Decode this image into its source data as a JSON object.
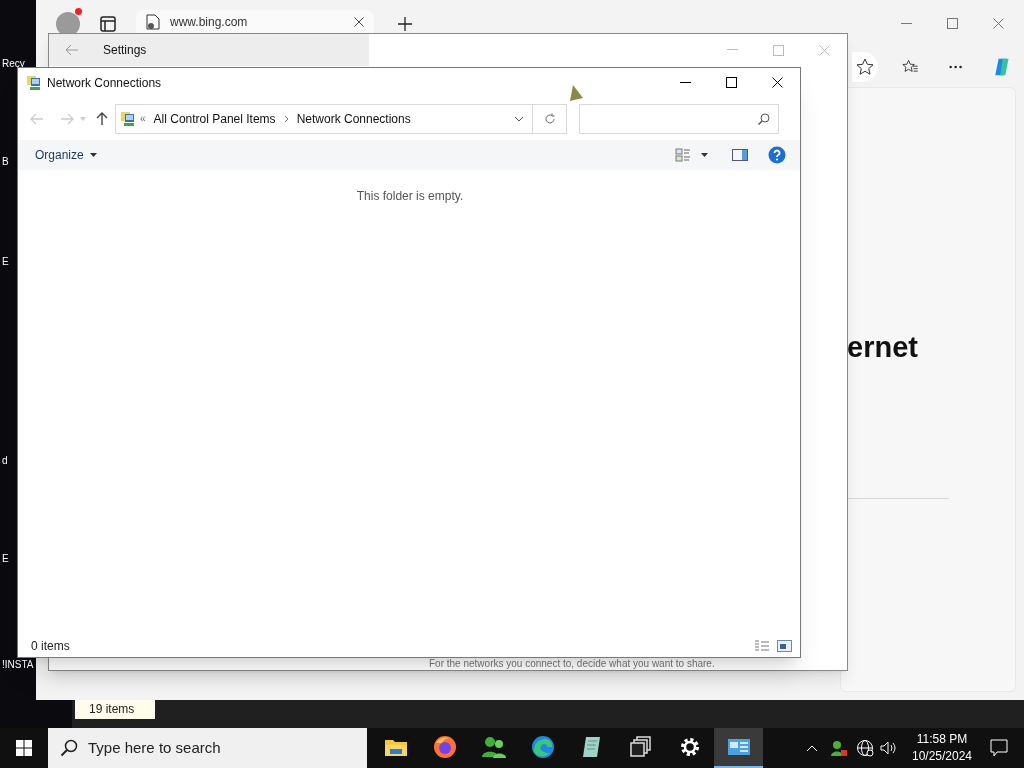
{
  "desktop_labels": [
    {
      "text": "Recy"
    },
    {
      "text": "B"
    },
    {
      "text": "E"
    },
    {
      "text": "d"
    },
    {
      "text": "E"
    },
    {
      "text": "!INSTA"
    }
  ],
  "browser": {
    "tab_title": "www.bing.com",
    "heading_fragment": "ernet"
  },
  "settings": {
    "title": "Settings",
    "description": "For the networks you connect to, decide what you want to share."
  },
  "explorer": {
    "title": "Network Connections",
    "breadcrumb_overflow": "«",
    "breadcrumb": [
      {
        "text": "All Control Panel Items"
      },
      {
        "text": "Network Connections"
      }
    ],
    "organize": "Organize",
    "empty_message": "This folder is empty.",
    "status": "0 items"
  },
  "background_window": {
    "status": "19 items"
  },
  "taskbar": {
    "search_placeholder": "Type here to search",
    "apps": [
      {
        "kind": "folder",
        "selected": false
      },
      {
        "kind": "firefox",
        "selected": false
      },
      {
        "kind": "people",
        "selected": false
      },
      {
        "kind": "edge",
        "selected": false
      },
      {
        "kind": "notepad",
        "selected": false
      },
      {
        "kind": "windows",
        "selected": false
      },
      {
        "kind": "gear",
        "selected": false
      },
      {
        "kind": "control-panel",
        "selected": true
      }
    ],
    "time": "11:58 PM",
    "date": "10/25/2024"
  }
}
